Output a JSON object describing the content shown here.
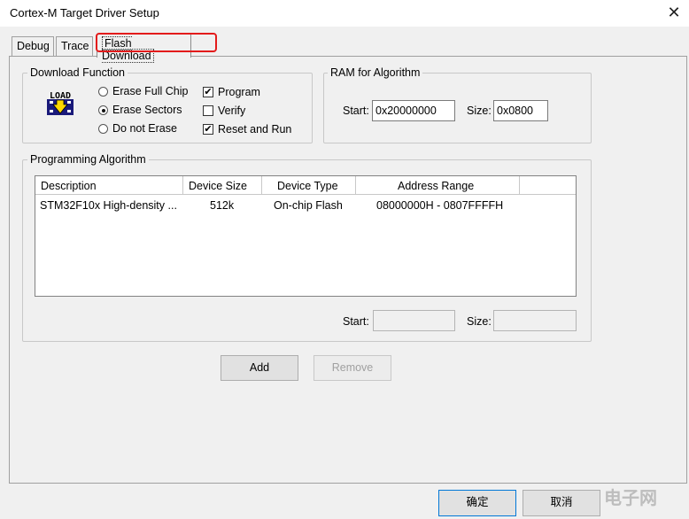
{
  "window": {
    "title": "Cortex-M Target Driver Setup"
  },
  "tabs": [
    {
      "label": "Debug"
    },
    {
      "label": "Trace"
    },
    {
      "label": "Flash Download"
    }
  ],
  "download_function": {
    "label": "Download Function",
    "erase_options": [
      {
        "label": "Erase Full Chip",
        "selected": false
      },
      {
        "label": "Erase Sectors",
        "selected": true
      },
      {
        "label": "Do not Erase",
        "selected": false
      }
    ],
    "checks": [
      {
        "label": "Program",
        "checked": true
      },
      {
        "label": "Verify",
        "checked": false
      },
      {
        "label": "Reset and Run",
        "checked": true
      }
    ],
    "icon_text": "LOAD"
  },
  "ram": {
    "label": "RAM for Algorithm",
    "start_label": "Start:",
    "start_value": "0x20000000",
    "size_label": "Size:",
    "size_value": "0x0800"
  },
  "programming_algorithm": {
    "label": "Programming Algorithm",
    "columns": [
      "Description",
      "Device Size",
      "Device Type",
      "Address Range"
    ],
    "rows": [
      [
        "STM32F10x High-density ...",
        "512k",
        "On-chip Flash",
        "08000000H - 0807FFFFH"
      ]
    ],
    "start_label": "Start:",
    "start_value": "",
    "size_label": "Size:",
    "size_value": ""
  },
  "buttons": {
    "add": "Add",
    "remove": "Remove",
    "ok": "确定",
    "cancel": "取消"
  },
  "watermark": "电子网"
}
